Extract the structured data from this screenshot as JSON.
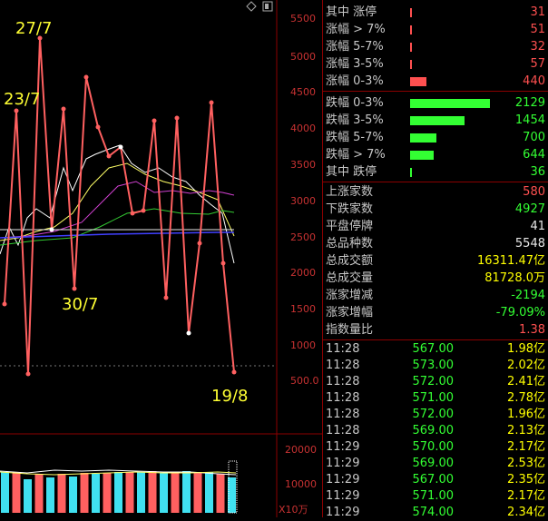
{
  "chart": {
    "annotations": [
      "27/7",
      "23/7",
      "30/7",
      "19/8"
    ],
    "y_axis_ticks": [
      "5500",
      "5000",
      "4500",
      "4000",
      "3500",
      "3000",
      "2500",
      "2000",
      "1500",
      "1000",
      "500.0"
    ],
    "volume_axis_ticks": [
      "20000",
      "10000"
    ],
    "volume_unit": "X10万",
    "icons": [
      "diamond-icon",
      "window-restore-icon"
    ]
  },
  "stats_up": [
    {
      "label": "其中 涨停",
      "value": "31",
      "bar": 0.01
    },
    {
      "label": "涨幅 > 7%",
      "value": "51",
      "bar": 0.02
    },
    {
      "label": "涨幅 5-7%",
      "value": "32",
      "bar": 0.01
    },
    {
      "label": "涨幅 3-5%",
      "value": "57",
      "bar": 0.02
    },
    {
      "label": "涨幅 0-3%",
      "value": "440",
      "bar": 0.2
    }
  ],
  "stats_down": [
    {
      "label": "跌幅 0-3%",
      "value": "2129",
      "bar": 1.0
    },
    {
      "label": "跌幅 3-5%",
      "value": "1454",
      "bar": 0.68
    },
    {
      "label": "跌幅 5-7%",
      "value": "700",
      "bar": 0.33
    },
    {
      "label": "跌幅 > 7%",
      "value": "644",
      "bar": 0.3
    },
    {
      "label": "其中 跌停",
      "value": "36",
      "bar": 0.01
    }
  ],
  "summary": [
    {
      "label": "上涨家数",
      "value": "580",
      "color": "#ff5050"
    },
    {
      "label": "下跌家数",
      "value": "4927",
      "color": "#33ff33"
    },
    {
      "label": "平盘停牌",
      "value": "41",
      "color": "#e8e8e8"
    },
    {
      "label": "总品种数",
      "value": "5548",
      "color": "#e8e8e8"
    },
    {
      "label": "总成交额",
      "value": "16311.47亿",
      "color": "#ffff00"
    },
    {
      "label": "总成交量",
      "value": "81728.0万",
      "color": "#ffff00"
    },
    {
      "label": "涨家增减",
      "value": "-2194",
      "color": "#33ff33"
    },
    {
      "label": "涨家增幅",
      "value": "-79.09%",
      "color": "#33ff33"
    },
    {
      "label": "指数量比",
      "value": "1.38",
      "color": "#ff5050"
    }
  ],
  "ticks": [
    {
      "time": "11:28",
      "price": "567.00",
      "amount": "1.98亿"
    },
    {
      "time": "11:28",
      "price": "573.00",
      "amount": "2.02亿"
    },
    {
      "time": "11:28",
      "price": "572.00",
      "amount": "2.41亿"
    },
    {
      "time": "11:28",
      "price": "571.00",
      "amount": "2.78亿"
    },
    {
      "time": "11:28",
      "price": "572.00",
      "amount": "1.96亿"
    },
    {
      "time": "11:28",
      "price": "569.00",
      "amount": "2.13亿"
    },
    {
      "time": "11:29",
      "price": "570.00",
      "amount": "2.17亿"
    },
    {
      "time": "11:29",
      "price": "569.00",
      "amount": "2.53亿"
    },
    {
      "time": "11:29",
      "price": "567.00",
      "amount": "2.35亿"
    },
    {
      "time": "11:29",
      "price": "571.00",
      "amount": "2.17亿"
    },
    {
      "time": "11:29",
      "price": "574.00",
      "amount": "2.34亿"
    }
  ],
  "colors": {
    "up": "#ff5050",
    "down": "#33ff33",
    "accent": "#ffff00",
    "grid": "#8b0000"
  }
}
